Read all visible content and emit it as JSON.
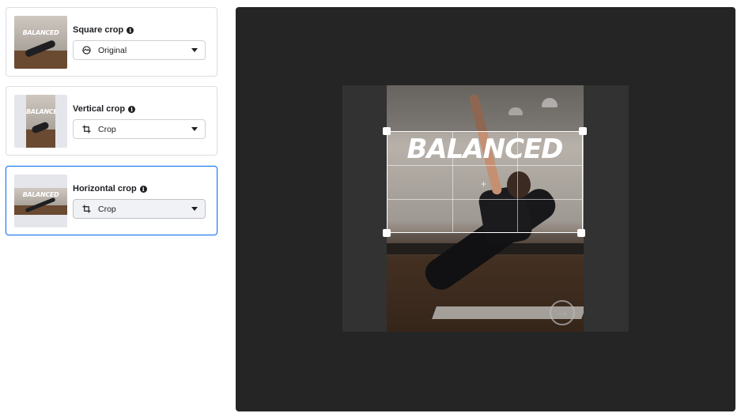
{
  "crop_options": [
    {
      "title": "Square crop",
      "value": "Original",
      "icon": "original-icon",
      "selected": false
    },
    {
      "title": "Vertical crop",
      "value": "Crop",
      "icon": "crop-icon",
      "selected": false
    },
    {
      "title": "Horizontal crop",
      "value": "Crop",
      "icon": "crop-icon",
      "selected": true
    }
  ],
  "preview": {
    "overlay_text": "BALANCED"
  },
  "colors": {
    "selected_border": "#1877f2",
    "editor_background": "#252525"
  }
}
